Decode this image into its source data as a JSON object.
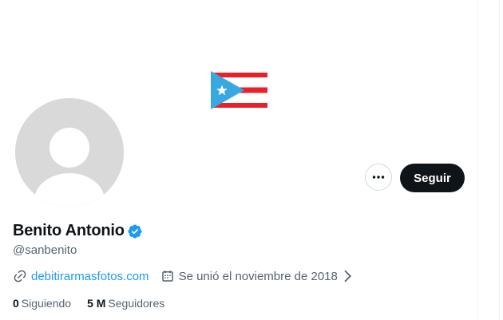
{
  "profile": {
    "display_name": "Benito Antonio",
    "handle": "@sanbenito",
    "website": "debitirarmasfotos.com",
    "joined": "Se unió el noviembre de 2018",
    "following_count": "0",
    "following_label": "Siguiendo",
    "followers_count": "5 M",
    "followers_label": "Seguidores"
  },
  "actions": {
    "follow_label": "Seguir"
  },
  "icons": {
    "more": "more-options-icon",
    "verified": "verified-badge-icon",
    "link": "link-icon",
    "calendar": "calendar-icon",
    "chevron": "chevron-right-icon",
    "flag": "puerto-rico-flag-icon"
  },
  "colors": {
    "accent": "#1d9bf0",
    "text": "#0f1419",
    "muted": "#536471",
    "button_bg": "#0f1419"
  }
}
